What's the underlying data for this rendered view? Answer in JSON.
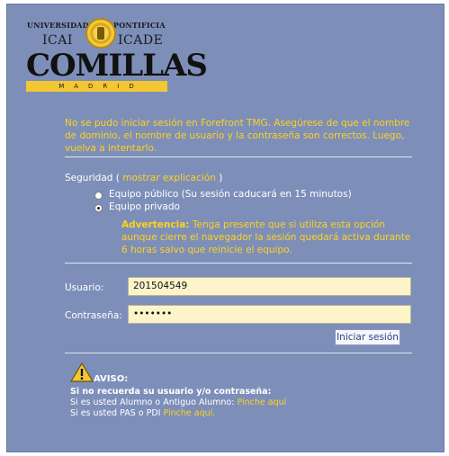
{
  "logo": {
    "univ": "UNIVERSIDAD",
    "pont": "PONTIFICIA",
    "icai": "ICAI",
    "icade": "ICADE",
    "name": "COMILLAS",
    "city": "MADRID"
  },
  "error_message": "No se pudo iniciar sesión en Forefront TMG. Asegúrese de que el nombre de dominio, el nombre de usuario y la contraseña son correctos. Luego, vuelva a intentarlo.",
  "security": {
    "label": "Seguridad",
    "open_paren": "(",
    "link": "mostrar explicación",
    "close_paren": ")",
    "public_option": "Equipo público (Su sesión caducará en 15 minutos)",
    "private_option": "Equipo privado",
    "selected": "private",
    "warning_title": "Advertencia:",
    "warning_text": "Tenga presente que si utiliza esta opción aunque cierre el navegador la sesión quedará activa durante 6 horas salvo que reinicie el equipo."
  },
  "form": {
    "user_label": "Usuario:",
    "user_value": "201504549",
    "pass_label": "Contraseña:",
    "pass_value": "•••••••",
    "submit_label": "Iniciar sesión"
  },
  "notice": {
    "title": "AVISO:",
    "heading": "Si no recuerda su usuario y/o contraseña:",
    "line1_text": "Si es usted Alumno o Antiguo Alumno:",
    "line1_link": "Pinche aquí",
    "line2_text": "Si es usted PAS o PDI",
    "line2_link": "Pinche aquí."
  },
  "colors": {
    "background": "#7d8fb9",
    "accent_yellow": "#ffd21f",
    "field_bg": "#fdf5c9"
  }
}
